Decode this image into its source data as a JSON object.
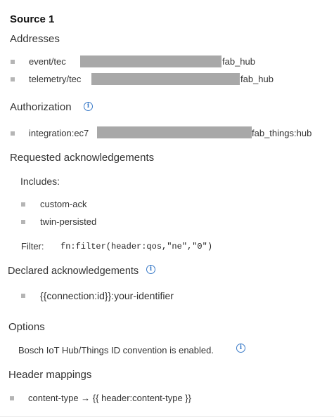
{
  "source": {
    "title": "Source 1",
    "addresses": {
      "heading": "Addresses",
      "items": [
        {
          "prefix": "event/tec",
          "suffix": "fab_hub"
        },
        {
          "prefix": "telemetry/tec",
          "suffix": "fab_hub"
        }
      ]
    },
    "authorization": {
      "heading": "Authorization",
      "items": [
        {
          "prefix": "integration:ec7",
          "suffix": "fab_things:hub"
        }
      ]
    },
    "requested_acks": {
      "heading": "Requested acknowledgements",
      "includes_label": "Includes:",
      "items": [
        "custom-ack",
        "twin-persisted"
      ],
      "filter_label": "Filter:",
      "filter_value": "fn:filter(header:qos,\"ne\",\"0\")"
    },
    "declared_acks": {
      "heading": "Declared acknowledgements",
      "items": [
        "{{connection:id}}:your-identifier"
      ]
    },
    "options": {
      "heading": "Options",
      "text": "Bosch IoT Hub/Things ID convention is enabled."
    },
    "header_mappings": {
      "heading": "Header mappings",
      "items": [
        "content-type → {{ header:content-type }}"
      ]
    }
  },
  "icons": {
    "info": "info-icon"
  },
  "colors": {
    "accent": "#3b7bc8",
    "redaction": "#a8a8a8",
    "bullet": "#b5b5b5"
  }
}
